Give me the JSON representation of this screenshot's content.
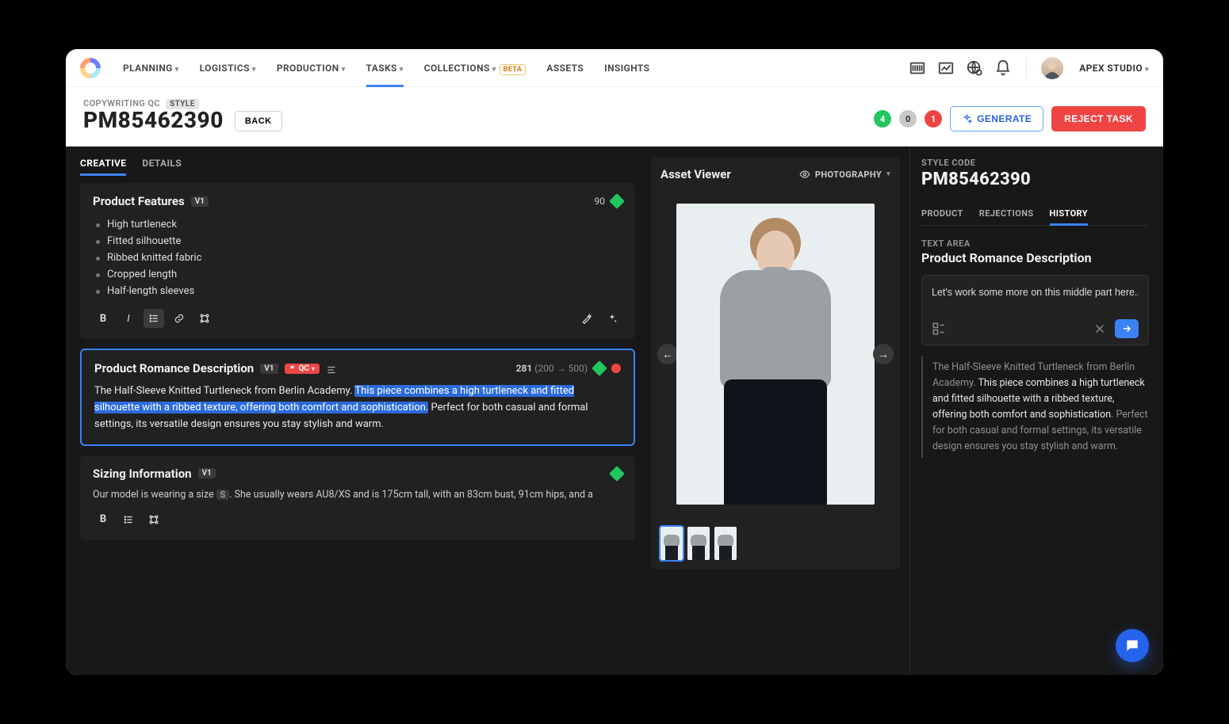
{
  "nav": {
    "items": [
      {
        "label": "PLANNING",
        "dropdown": true
      },
      {
        "label": "LOGISTICS",
        "dropdown": true
      },
      {
        "label": "PRODUCTION",
        "dropdown": true
      },
      {
        "label": "TASKS",
        "dropdown": true,
        "active": true
      },
      {
        "label": "COLLECTIONS",
        "dropdown": true,
        "beta": true
      },
      {
        "label": "ASSETS",
        "dropdown": false
      },
      {
        "label": "INSIGHTS",
        "dropdown": false
      }
    ],
    "beta_label": "BETA",
    "user": "APEX STUDIO"
  },
  "header": {
    "breadcrumb": "COPYWRITING QC",
    "style_chip": "STYLE",
    "title": "PM85462390",
    "back": "BACK",
    "counts": {
      "green": "4",
      "grey": "0",
      "red": "1"
    },
    "generate": "GENERATE",
    "reject": "REJECT TASK"
  },
  "left": {
    "tabs": [
      "CREATIVE",
      "DETAILS"
    ],
    "features": {
      "title": "Product Features",
      "version": "V1",
      "score": "90",
      "items": [
        "High turtleneck",
        "Fitted silhouette",
        "Ribbed knitted fabric",
        "Cropped length",
        "Half-length sleeves"
      ]
    },
    "romance": {
      "title": "Product Romance Description",
      "version": "V1",
      "qc": "QC",
      "count": "281",
      "range_from": "200",
      "range_to": "500",
      "text_pre": "The Half-Sleeve Knitted Turtleneck from Berlin Academy. ",
      "text_hl": "This piece combines a high turtleneck and fitted silhouette with a ribbed texture, offering both comfort and sophistication.",
      "text_post": " Perfect for both casual and formal settings, its versatile design ensures you stay stylish and warm."
    },
    "sizing": {
      "title": "Sizing Information",
      "version": "V1",
      "text_pre": "Our model is wearing a size ",
      "size_key": "S",
      "text_post": ". She usually wears AU8/XS and is 175cm tall, with an 83cm bust, 91cm hips, and a"
    }
  },
  "asset": {
    "title": "Asset Viewer",
    "mode": "PHOTOGRAPHY"
  },
  "right": {
    "sc_label": "STYLE CODE",
    "sc_value": "PM85462390",
    "tabs": [
      "PRODUCT",
      "REJECTIONS",
      "HISTORY"
    ],
    "ta_label": "TEXT AREA",
    "ta_title": "Product Romance Description",
    "chat_value": "Let's work some more on this middle part here...",
    "quote_pre": "The Half-Sleeve Knitted Turtleneck from Berlin Academy. ",
    "quote_em": "This piece combines a high turtleneck and fitted silhouette with a ribbed texture, offering both comfort and sophistication",
    "quote_post": ". Perfect for both casual and formal settings, its versatile design ensures you stay stylish and warm."
  }
}
